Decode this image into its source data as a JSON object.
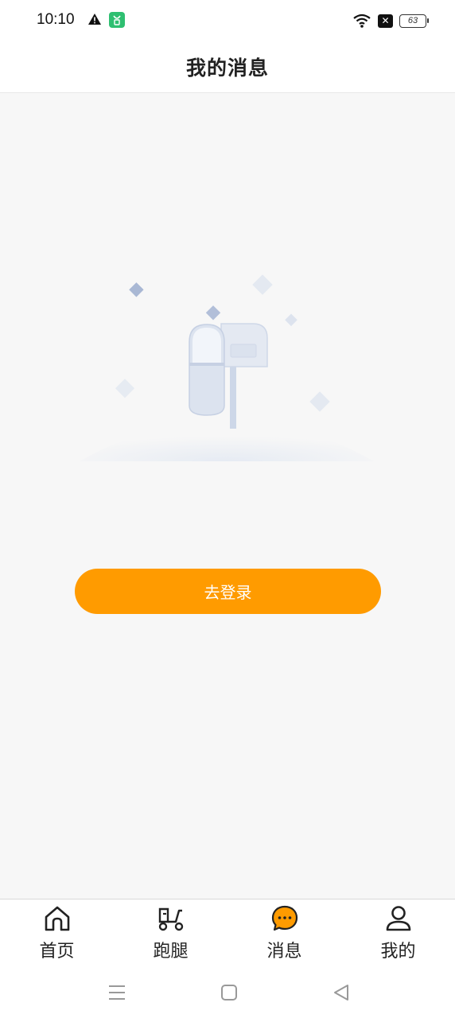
{
  "status_bar": {
    "time": "10:10",
    "battery": "63"
  },
  "header": {
    "title": "我的消息"
  },
  "main": {
    "login_button": "去登录"
  },
  "tab_bar": {
    "tabs": [
      {
        "label": "首页",
        "icon": "home-icon",
        "active": false
      },
      {
        "label": "跑腿",
        "icon": "scooter-icon",
        "active": false
      },
      {
        "label": "消息",
        "icon": "chat-bubble-icon",
        "active": true
      },
      {
        "label": "我的",
        "icon": "user-icon",
        "active": false
      }
    ]
  },
  "colors": {
    "accent": "#ff9b00",
    "background": "#f7f7f7",
    "text": "#222222"
  }
}
